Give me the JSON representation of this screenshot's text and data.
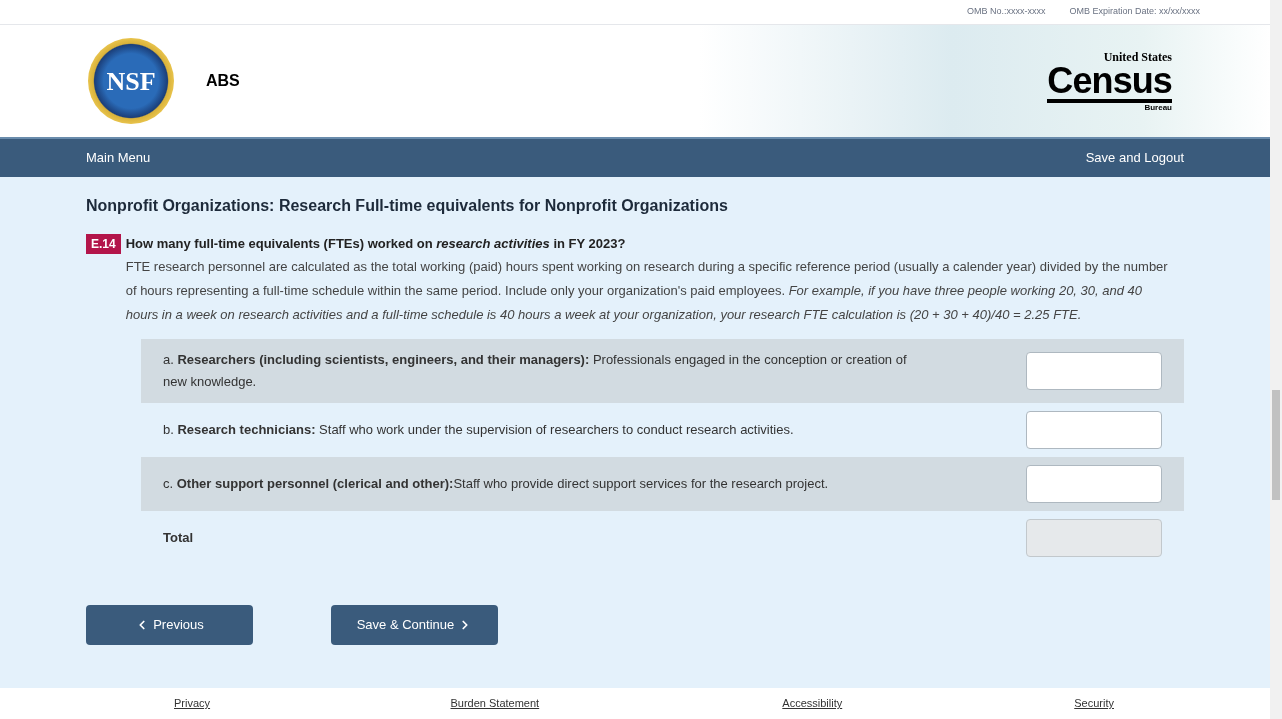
{
  "omb": {
    "number": "OMB No.:xxxx-xxxx",
    "expiration": "OMB Expiration Date: xx/xx/xxxx"
  },
  "header": {
    "logo_text": "NSF",
    "survey": "ABS",
    "census": {
      "top": "United States",
      "name": "Census",
      "bottom": "Bureau"
    }
  },
  "nav": {
    "left": "Main Menu",
    "right": "Save and Logout"
  },
  "page_title": "Nonprofit Organizations: Research Full-time equivalents for Nonprofit Organizations",
  "question": {
    "number": "E.14",
    "text": "How many full-time equivalents (FTEs) worked on *research activities* in FY 2023?",
    "description": "FTE research personnel are calculated as the total working (paid) hours spent working on research during a specific reference period (usually a calender year) divided by the number of hours representing a full-time schedule within the same period. Include only your organization's paid employees. *For example, if you have three people working 20, 30, and 40 hours in a week on research activities and a full-time schedule is 40 hours a week at your organization, your research FTE calculation is (20 + 30 + 40)/40 = 2.25 FTE.*"
  },
  "rows": [
    {
      "label": "a. **Researchers (including scientists, engineers, and their managers):** Professionals engaged in the conception or creation of new knowledge.",
      "disabled": false
    },
    {
      "label": "b. **Research technicians:** Staff who work under the supervision of researchers to conduct research activities.",
      "disabled": false
    },
    {
      "label": "c. **Other support personnel (clerical and other):**Staff who provide direct support services for the research project.",
      "disabled": false
    },
    {
      "label": "**Total**",
      "disabled": true
    }
  ],
  "buttons": {
    "previous": "Previous",
    "next": "Save & Continue"
  },
  "footer": [
    "Privacy",
    "Burden Statement",
    "Accessibility",
    "Security"
  ]
}
